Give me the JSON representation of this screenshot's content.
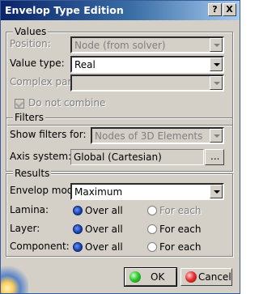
{
  "window": {
    "title": "Envelop Type Edition",
    "help_label": "?",
    "close_label": "X"
  },
  "values": {
    "legend": "Values",
    "position_label": "Position:",
    "position_value": "Node (from solver)",
    "value_type_label": "Value type:",
    "value_type_value": "Real",
    "complex_part_label": "Complex part:",
    "complex_part_value": "",
    "do_not_combine_label": "Do not combine"
  },
  "filters": {
    "legend": "Filters",
    "show_filters_label": "Show filters for:",
    "show_filters_value": "Nodes of 3D Elements",
    "axis_system_label": "Axis system:",
    "axis_system_value": "Global (Cartesian)",
    "browse_label": "..."
  },
  "results": {
    "legend": "Results",
    "envelop_mode_label": "Envelop mode:",
    "envelop_mode_value": "Maximum",
    "over_all_label": "Over all",
    "for_each_label": "For each",
    "rows": [
      {
        "label": "Lamina:",
        "selected": "over_all",
        "for_each_enabled": false
      },
      {
        "label": "Layer:",
        "selected": "over_all",
        "for_each_enabled": true
      },
      {
        "label": "Component:",
        "selected": "over_all",
        "for_each_enabled": true
      }
    ]
  },
  "buttons": {
    "ok_label": "OK",
    "cancel_label": "Cancel"
  },
  "colors": {
    "title_start": "#0a246a",
    "title_end": "#a6caf0",
    "face": "#d4d0c8"
  }
}
